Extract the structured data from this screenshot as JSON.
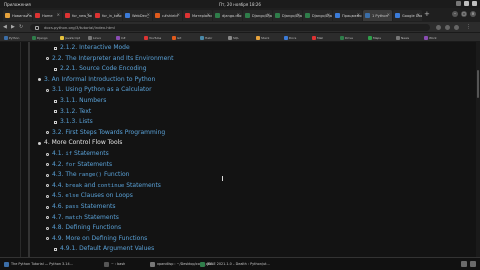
{
  "topbar": {
    "menu": "Приложения",
    "clock": "Пт, 20 ноября 18:26"
  },
  "tabs": [
    {
      "label": "Новинки во",
      "color": "#e6a23c"
    },
    {
      "label": "Home",
      "color": "#d33"
    },
    {
      "label": "for_new_lan",
      "color": "#d33"
    },
    {
      "label": "for_in_kosc",
      "color": "#d33"
    },
    {
      "label": "WebDev_",
      "color": "#3b7bd8"
    },
    {
      "label": "c#shield",
      "color": "#e05a1c"
    },
    {
      "label": "Матеріали",
      "color": "#d33"
    },
    {
      "label": "django.doc",
      "color": "#2f7d4a"
    },
    {
      "label": "Django/Django",
      "color": "#2f7d4a"
    },
    {
      "label": "Django/Django",
      "color": "#2f7d4a"
    },
    {
      "label": "Django/Django",
      "color": "#2f7d4a"
    },
    {
      "label": "Працюємо з",
      "color": "#3b7bd8"
    },
    {
      "label": "1 Python",
      "color": "#3b6ea8",
      "active": true
    },
    {
      "label": "Google DocS",
      "color": "#3b7bd8"
    }
  ],
  "address": {
    "url": "docs.python.org/3/tutorial/index.html"
  },
  "bookmarks": [
    {
      "label": "Python",
      "color": "#3b6ea8"
    },
    {
      "label": "Django",
      "color": "#2f7d4a"
    },
    {
      "label": "JavaScript",
      "color": "#e6c23c"
    },
    {
      "label": "Linux",
      "color": "#777"
    },
    {
      "label": "C#",
      "color": "#8a4db3"
    },
    {
      "label": "YouTube",
      "color": "#d33"
    },
    {
      "label": "Git",
      "color": "#e05a1c"
    },
    {
      "label": "Habr",
      "color": "#4a89a8"
    },
    {
      "label": "SQL",
      "color": "#888"
    },
    {
      "label": "Stack",
      "color": "#e6a23c"
    },
    {
      "label": "Docs",
      "color": "#3b7bd8"
    },
    {
      "label": "Mail",
      "color": "#d33"
    },
    {
      "label": "Drive",
      "color": "#2f7d4a"
    },
    {
      "label": "Maps",
      "color": "#2f9d4a"
    },
    {
      "label": "News",
      "color": "#777"
    },
    {
      "label": "Work",
      "color": "#8a4db3"
    }
  ],
  "toc": [
    {
      "num": "2.1.2.",
      "text": "Interactive Mode",
      "level": 3
    },
    {
      "num": "2.2.",
      "text": "The Interpreter and Its Environment",
      "level": 2
    },
    {
      "num": "2.2.1.",
      "text": "Source Code Encoding",
      "level": 3
    },
    {
      "num": "3.",
      "text": "An Informal Introduction to Python",
      "level": 1
    },
    {
      "num": "3.1.",
      "text": "Using Python as a Calculator",
      "level": 2
    },
    {
      "num": "3.1.1.",
      "text": "Numbers",
      "level": 3
    },
    {
      "num": "3.1.2.",
      "text": "Text",
      "level": 3
    },
    {
      "num": "3.1.3.",
      "text": "Lists",
      "level": 3
    },
    {
      "num": "3.2.",
      "text": "First Steps Towards Programming",
      "level": 2
    },
    {
      "num": "4.",
      "text": "More Control Flow Tools",
      "level": 1,
      "white": true
    },
    {
      "num": "4.1.",
      "code": "if",
      "text": "Statements",
      "level": 2
    },
    {
      "num": "4.2.",
      "code": "for",
      "text": "Statements",
      "level": 2
    },
    {
      "num": "4.3.",
      "pre": "The",
      "code": "range()",
      "text": "Function",
      "level": 2
    },
    {
      "num": "4.4.",
      "code": "break",
      "mid": "and",
      "code2": "continue",
      "text": "Statements",
      "level": 2
    },
    {
      "num": "4.5.",
      "code": "else",
      "text": "Clauses on Loops",
      "level": 2
    },
    {
      "num": "4.6.",
      "code": "pass",
      "text": "Statements",
      "level": 2
    },
    {
      "num": "4.7.",
      "code": "match",
      "text": "Statements",
      "level": 2
    },
    {
      "num": "4.8.",
      "text": "Defining Functions",
      "level": 2
    },
    {
      "num": "4.9.",
      "text": "More on Defining Functions",
      "level": 2
    },
    {
      "num": "4.9.1.",
      "text": "Default Argument Values",
      "level": 3
    }
  ],
  "taskbar": [
    {
      "label": "The Python Tutorial — Python 3.14...",
      "color": "#3b6ea8"
    },
    {
      "label": "~ : bash",
      "color": "#555"
    },
    {
      "label": "xpandlisp : ~/Desktop/code_oth...",
      "color": "#777"
    },
    {
      "label": "[DNE 2021.1.0 – Dealth : Python/ut...",
      "color": "#2f7d4a"
    }
  ]
}
